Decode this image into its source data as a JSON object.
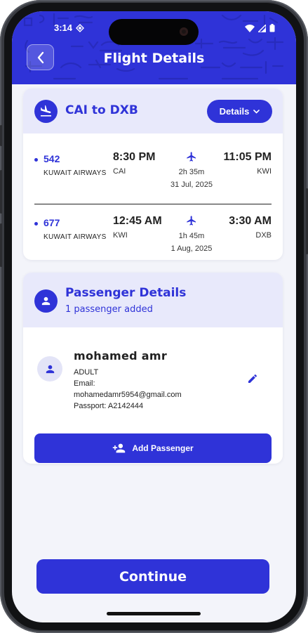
{
  "status_bar": {
    "time": "3:14"
  },
  "header": {
    "title": "Flight Details"
  },
  "flight_card": {
    "route_title": "CAI to DXB",
    "details_button": "Details",
    "segments": [
      {
        "flight_number": "542",
        "airline": "KUWAIT AIRWAYS",
        "departure_time": "8:30 PM",
        "departure_code": "CAI",
        "duration": "2h 35m",
        "date": "31 Jul, 2025",
        "arrival_time": "11:05 PM",
        "arrival_code": "KWI"
      },
      {
        "flight_number": "677",
        "airline": "KUWAIT AIRWAYS",
        "departure_time": "12:45 AM",
        "departure_code": "KWI",
        "duration": "1h 45m",
        "date": "1 Aug, 2025",
        "arrival_time": "3:30 AM",
        "arrival_code": "DXB"
      }
    ]
  },
  "passenger_card": {
    "title": "Passenger Details",
    "subtitle": "1 passenger added",
    "passenger": {
      "name": "mohamed amr",
      "type": "ADULT",
      "email_label": "Email:",
      "email": "mohamedamr5954@gmail.com",
      "passport": "Passport: A2142444"
    },
    "add_button": "Add Passenger"
  },
  "footer": {
    "continue_button": "Continue"
  },
  "colors": {
    "primary": "#2f33d8",
    "header_tint": "#e8e9fb",
    "background": "#f3f4fa"
  },
  "icons": [
    "back-chevron-icon",
    "flight-land-icon",
    "chevron-down-icon",
    "airplane-icon",
    "person-icon",
    "edit-pencil-icon",
    "person-add-icon"
  ]
}
